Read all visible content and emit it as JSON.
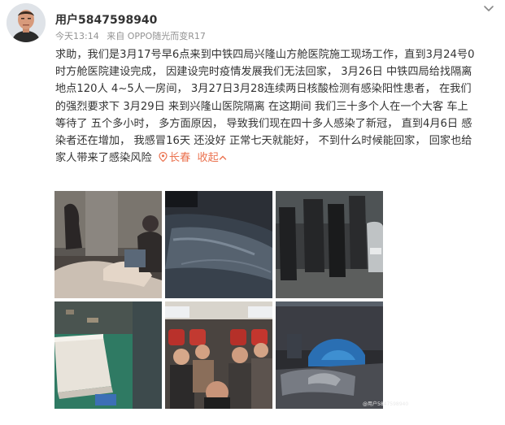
{
  "post": {
    "username": "用户5847598940",
    "time": "今天13:14",
    "source": "来自 OPPO随光而变R17",
    "text_lines": [
      "求助，我们是3月17号早6点来到中铁四局兴隆山方舱医院施工现场工作，直到3月24号0",
      "时方舱医院建设完成， 因建设完时疫情发展我们无法回家， 3月26日 中铁四局给找隔离",
      "地点120人 4~5人一房间，  3月27日3月28连续两日核酸检测有感染阳性患者， 在我们",
      "的强烈要求下 3月29日 来到兴隆山医院隔离 在这期间 我们三十多个人在一个大客 车上",
      "等待了 五个多小时， 多方面原因，  导致我们现在四十多人感染了新冠， 直到4月6日 感",
      "染者还在增加， 我感冒16天 还没好 正常七天就能好， 不到什么时候能回家，  回家也给"
    ],
    "last_line_text": "家人带来了感染风险",
    "location": "长春",
    "collapse_label": "收起"
  },
  "photos": [
    {
      "name": "photo-dorm-room"
    },
    {
      "name": "photo-car-windshield"
    },
    {
      "name": "photo-people-standing"
    },
    {
      "name": "photo-mattress-floor"
    },
    {
      "name": "photo-bus-interior"
    },
    {
      "name": "photo-tent-bed"
    }
  ],
  "watermark": "@用户5847598940",
  "colors": {
    "accent": "#eb7350",
    "meta_gray": "#939393",
    "text": "#333333"
  },
  "icons": {
    "more": "chevron-down-icon",
    "location": "location-pin-icon",
    "collapse": "chevron-up-icon"
  }
}
